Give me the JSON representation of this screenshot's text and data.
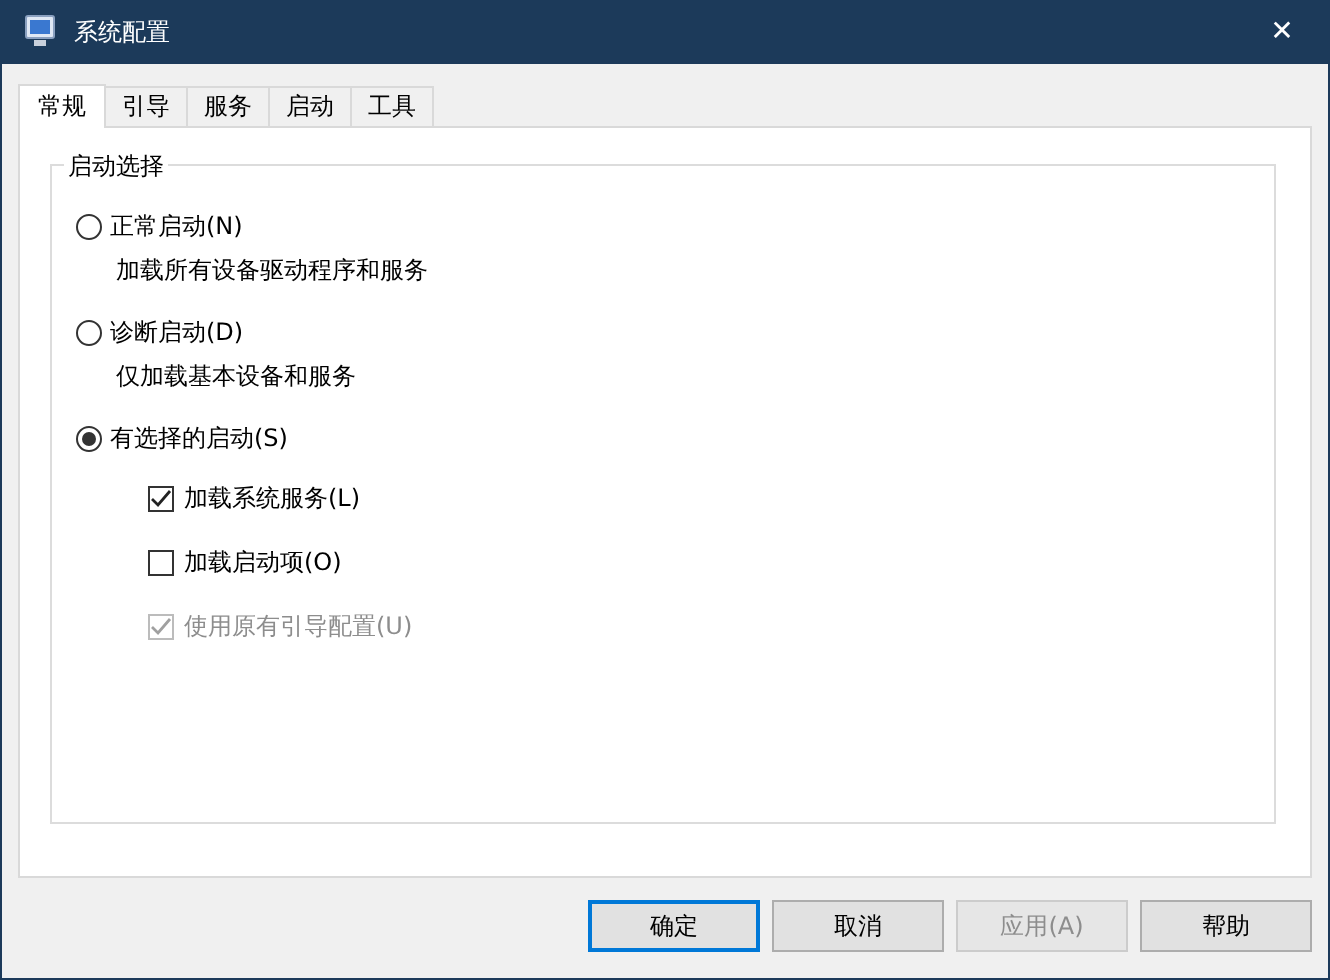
{
  "window": {
    "title": "系统配置",
    "close": "✕"
  },
  "tabs": [
    {
      "label": "常规",
      "selected": true
    },
    {
      "label": "引导",
      "selected": false
    },
    {
      "label": "服务",
      "selected": false
    },
    {
      "label": "启动",
      "selected": false
    },
    {
      "label": "工具",
      "selected": false
    }
  ],
  "group": {
    "title": "启动选择",
    "options": [
      {
        "label": "正常启动(N)",
        "description": "加载所有设备驱动程序和服务",
        "selected": false
      },
      {
        "label": "诊断启动(D)",
        "description": "仅加载基本设备和服务",
        "selected": false
      },
      {
        "label": "有选择的启动(S)",
        "selected": true
      }
    ],
    "selective_items": [
      {
        "label": "加载系统服务(L)",
        "checked": true,
        "disabled": false
      },
      {
        "label": "加载启动项(O)",
        "checked": false,
        "disabled": false
      },
      {
        "label": "使用原有引导配置(U)",
        "checked": true,
        "disabled": true
      }
    ]
  },
  "buttons": [
    {
      "label": "确定",
      "default": true,
      "disabled": false
    },
    {
      "label": "取消",
      "default": false,
      "disabled": false
    },
    {
      "label": "应用(A)",
      "default": false,
      "disabled": true
    },
    {
      "label": "帮助",
      "default": false,
      "disabled": false
    }
  ]
}
